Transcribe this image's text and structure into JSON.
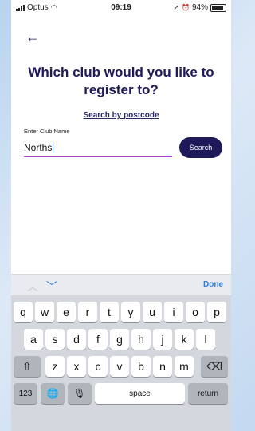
{
  "status": {
    "carrier": "Optus",
    "time": "09:19",
    "battery": "94%"
  },
  "nav": {
    "back_icon": "←"
  },
  "page": {
    "title": "Which club would you like to register to?",
    "postcode_link": "Search by postcode",
    "field_label": "Enter Club Name",
    "field_value": "Norths",
    "search_button": "Search"
  },
  "keyboard": {
    "done": "Done",
    "row1": [
      "q",
      "w",
      "e",
      "r",
      "t",
      "y",
      "u",
      "i",
      "o",
      "p"
    ],
    "row2": [
      "a",
      "s",
      "d",
      "f",
      "g",
      "h",
      "j",
      "k",
      "l"
    ],
    "row3": [
      "z",
      "x",
      "c",
      "v",
      "b",
      "n",
      "m"
    ],
    "numbers": "123",
    "space": "space",
    "return": "return",
    "shift_icon": "⇧",
    "backspace_icon": "⌫",
    "globe_icon": "🌐",
    "mic_icon": "🎙"
  }
}
